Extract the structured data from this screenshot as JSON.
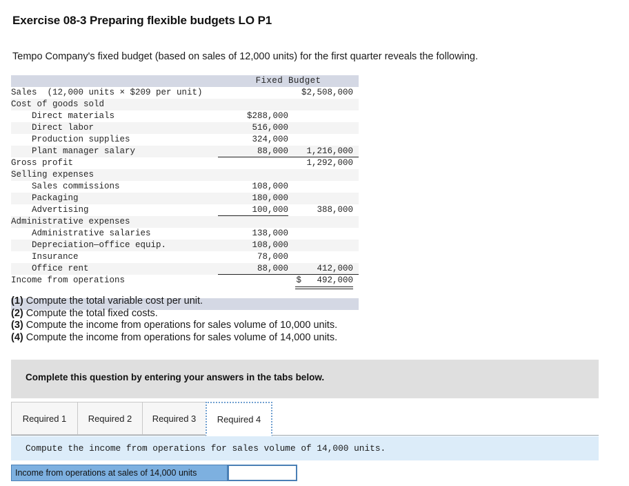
{
  "header": {
    "title": "Exercise 08-3 Preparing flexible budgets LO P1",
    "intro": "Tempo Company's fixed budget (based on sales of 12,000 units) for the first quarter reveals the following."
  },
  "budget_table": {
    "column_header": "Fixed Budget",
    "rows": [
      {
        "label": "Sales  (12,000 units × $209 per unit)",
        "indent": 0,
        "a": "",
        "b": "$2,508,000",
        "shaded": false
      },
      {
        "label": "Cost of goods sold",
        "indent": 0,
        "a": "",
        "b": "",
        "shaded": true
      },
      {
        "label": "Direct materials",
        "indent": 1,
        "a": "$288,000",
        "b": "",
        "shaded": false
      },
      {
        "label": "Direct labor",
        "indent": 1,
        "a": "516,000",
        "b": "",
        "shaded": true
      },
      {
        "label": "Production supplies",
        "indent": 1,
        "a": "324,000",
        "b": "",
        "shaded": false
      },
      {
        "label": "Plant manager salary",
        "indent": 1,
        "a": "88,000",
        "b": "1,216,000",
        "shaded": true,
        "rule_a": true,
        "rule_b": true
      },
      {
        "label": "Gross profit",
        "indent": 0,
        "a": "",
        "b": "1,292,000",
        "shaded": false
      },
      {
        "label": "Selling expenses",
        "indent": 0,
        "a": "",
        "b": "",
        "shaded": true
      },
      {
        "label": "Sales commissions",
        "indent": 1,
        "a": "108,000",
        "b": "",
        "shaded": false
      },
      {
        "label": "Packaging",
        "indent": 1,
        "a": "180,000",
        "b": "",
        "shaded": true
      },
      {
        "label": "Advertising",
        "indent": 1,
        "a": "100,000",
        "b": "388,000",
        "shaded": false,
        "rule_a": true
      },
      {
        "label": "Administrative expenses",
        "indent": 0,
        "a": "",
        "b": "",
        "shaded": true
      },
      {
        "label": "Administrative salaries",
        "indent": 1,
        "a": "138,000",
        "b": "",
        "shaded": false
      },
      {
        "label": "Depreciation—office equip.",
        "indent": 1,
        "a": "108,000",
        "b": "",
        "shaded": true
      },
      {
        "label": "Insurance",
        "indent": 1,
        "a": "78,000",
        "b": "",
        "shaded": false
      },
      {
        "label": "Office rent",
        "indent": 1,
        "a": "88,000",
        "b": "412,000",
        "shaded": true,
        "rule_a": true,
        "rule_b": true
      },
      {
        "label": "Income from operations",
        "indent": 0,
        "a": "",
        "b": "$   492,000",
        "shaded": false,
        "double_b": true
      }
    ]
  },
  "requirements": [
    {
      "num": "(1)",
      "text": " Compute the total variable cost per unit."
    },
    {
      "num": "(2)",
      "text": " Compute the total fixed costs."
    },
    {
      "num": "(3)",
      "text": " Compute the income from operations for sales volume of 10,000 units."
    },
    {
      "num": "(4)",
      "text": " Compute the income from operations for sales volume of 14,000 units."
    }
  ],
  "complete_banner": {
    "text": "Complete this question by entering your answers in the tabs below."
  },
  "tabs": {
    "items": [
      {
        "label": "Required 1",
        "active": false
      },
      {
        "label": "Required 2",
        "active": false
      },
      {
        "label": "Required 3",
        "active": false
      },
      {
        "label": "Required 4",
        "active": true
      }
    ]
  },
  "requirement_bar": {
    "text": "Compute the income from operations for sales volume of 14,000 units."
  },
  "answer_row": {
    "label": "Income from operations at sales of 14,000 units",
    "value": "",
    "placeholder": ""
  },
  "colors": {
    "table_header_bg": "#d4d8e4",
    "table_shade_bg": "#f4f4f4",
    "banner_bg": "#dfdfdf",
    "req_bar_bg": "#dcecf9",
    "answer_label_bg": "#7db0e0",
    "answer_border": "#4a7fb5",
    "tab_active_border": "#6f9fd0"
  }
}
